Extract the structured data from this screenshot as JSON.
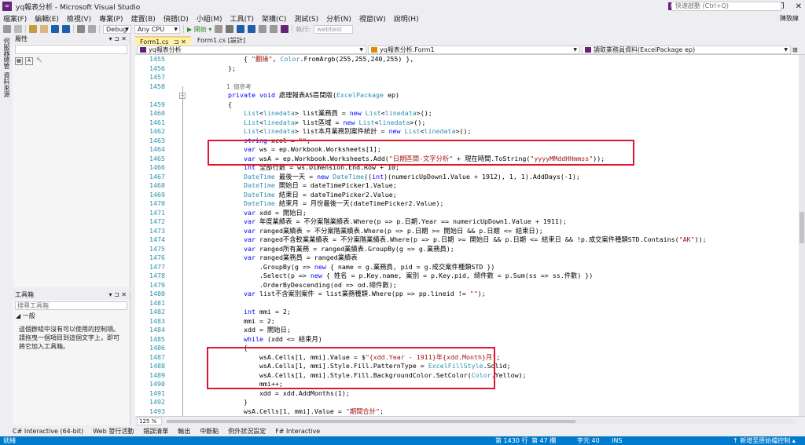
{
  "window": {
    "title": "yq報表分析 - Microsoft Visual Studio",
    "controls": [
      "—",
      "❐",
      "✕"
    ]
  },
  "menu": [
    "檔案(F)",
    "編輯(E)",
    "檢視(V)",
    "專案(P)",
    "建置(B)",
    "偵錯(D)",
    "小組(M)",
    "工具(T)",
    "架構(C)",
    "測試(S)",
    "分析(N)",
    "視窗(W)",
    "說明(H)"
  ],
  "quick_launch_placeholder": "快速啟動 (Ctrl+Q)",
  "user": "陳致緯",
  "toolbar": {
    "config": "Debug",
    "platform": "Any CPU",
    "start": "▶ 開始 ▾",
    "branch_label": "執行:",
    "branch": "webtest"
  },
  "left_strip": [
    "伺服器總管",
    "資料來源"
  ],
  "properties": {
    "title": "屬性",
    "pin": "▾ ⊐ ✕"
  },
  "toolbox": {
    "title": "工具箱",
    "pin": "▾ ⊐ ✕",
    "search_placeholder": "搜尋工具箱",
    "general": "◢ 一般",
    "message": "這個群組中沒有可以使用的控制項。請拖曳一個項目到這個文字上，即可將它加入工具箱。"
  },
  "editor_tabs": [
    {
      "label": "Form1.cs",
      "pin": "⊐ ✕",
      "active": true
    },
    {
      "label": "Form1.cs [設計]",
      "pin": "",
      "active": false
    }
  ],
  "nav": {
    "project": "yq報表分析",
    "class": "yq報表分析.Form1",
    "member": "讀取業務員資料(ExcelPackage ep)"
  },
  "code_lines": [
    {
      "n": "1455",
      "t": "        { \"翻綠\", Color.FromArgb(255,255,240,255) },",
      "c": "st"
    },
    {
      "n": "1456",
      "t": "    };",
      "c": ""
    },
    {
      "n": "1457",
      "t": "",
      "c": ""
    },
    {
      "n": "1458",
      "t": "    1 個參考",
      "c": "ref"
    },
    {
      "n": "",
      "t": "    private void 處理報表AS區間版(ExcelPackage ep)",
      "c": "sig"
    },
    {
      "n": "1459",
      "t": "    {",
      "c": ""
    },
    {
      "n": "1460",
      "t": "        List<linedata> list業務員 = new List<linedata>();",
      "c": ""
    },
    {
      "n": "1461",
      "t": "        List<linedata> list區域 = new List<linedata>();",
      "c": ""
    },
    {
      "n": "1462",
      "t": "        List<linedata> list本月業務別案件統計 = new List<linedata>();",
      "c": ""
    },
    {
      "n": "1463",
      "t": "        string xcol = \"\";",
      "c": ""
    },
    {
      "n": "1464",
      "t": "        var ws = ep.Workbook.Worksheets[1];",
      "c": ""
    },
    {
      "n": "1465",
      "t": "        var wsA = ep.Workbook.Worksheets.Add(\"日期區間-文字分析\" + 現在時間.ToString(\"yyyyMMddHHmmss\"));",
      "c": ""
    },
    {
      "n": "1466",
      "t": "        int 全部行數 = ws.Dimension.End.Row + 10;",
      "c": ""
    },
    {
      "n": "1467",
      "t": "        DateTime 最後一天 = new DateTime((int)(numericUpDown1.Value + 1912), 1, 1).AddDays(-1);",
      "c": ""
    },
    {
      "n": "1468",
      "t": "        DateTime 開始日 = dateTimePicker1.Value;",
      "c": ""
    },
    {
      "n": "1469",
      "t": "        DateTime 結束日 = dateTimePicker2.Value;",
      "c": ""
    },
    {
      "n": "1470",
      "t": "        DateTime 結束月 = 月份最後一天(dateTimePicker2.Value);",
      "c": ""
    },
    {
      "n": "1471",
      "t": "        var xdd = 開始日;",
      "c": ""
    },
    {
      "n": "1472",
      "t": "        var 年度業績表 = 不分案階業績表.Where(p => p.日期.Year == numericUpDown1.Value + 1911);",
      "c": ""
    },
    {
      "n": "1473",
      "t": "        var ranged業績表 = 不分案階業績表.Where(p => p.日期 >= 開始日 && p.日期 <= 結束日);",
      "c": ""
    },
    {
      "n": "1474",
      "t": "        var ranged不含較業業績表 = 不分案階業績表.Where(p => p.日期 >= 開始日 && p.日期 <= 結束日 && !p.成交案件種類STD.Contains(\"AK\"));",
      "c": ""
    },
    {
      "n": "1475",
      "t": "        var ranged所有業務 = ranged業績表.GroupBy(g => g.業務員);",
      "c": ""
    },
    {
      "n": "1476",
      "t": "        var ranged業務員 = ranged業績表",
      "c": ""
    },
    {
      "n": "1477",
      "t": "            .GroupBy(g => new { name = g.業務員, pid = g.成交案件種類STD })",
      "c": ""
    },
    {
      "n": "1478",
      "t": "            .Select(p => new { 姓名 = p.Key.name, 案別 = p.Key.pid, 總件數 = p.Sum(ss => ss.件數) })",
      "c": ""
    },
    {
      "n": "1479",
      "t": "            .OrderByDescending(od => od.總件數);",
      "c": ""
    },
    {
      "n": "1480",
      "t": "        var list不含案別案件 = list業務種類.Where(pp => pp.lineid != \"\");",
      "c": ""
    },
    {
      "n": "1481",
      "t": "",
      "c": ""
    },
    {
      "n": "1482",
      "t": "        int mmi = 2;",
      "c": ""
    },
    {
      "n": "1483",
      "t": "        mmi = 2;",
      "c": ""
    },
    {
      "n": "1484",
      "t": "        xdd = 開始日;",
      "c": ""
    },
    {
      "n": "1485",
      "t": "        while (xdd <= 結束月)",
      "c": ""
    },
    {
      "n": "1486",
      "t": "        {",
      "c": ""
    },
    {
      "n": "1487",
      "t": "            wsA.Cells[1, mmi].Value = $\"{xdd.Year - 1911}年{xdd.Month}月\";",
      "c": ""
    },
    {
      "n": "1488",
      "t": "            wsA.Cells[1, mmi].Style.Fill.PatternType = ExcelFillStyle.Solid;",
      "c": ""
    },
    {
      "n": "1489",
      "t": "            wsA.Cells[1, mmi].Style.Fill.BackgroundColor.SetColor(Color.Yellow);",
      "c": ""
    },
    {
      "n": "1490",
      "t": "            mmi++;",
      "c": ""
    },
    {
      "n": "1491",
      "t": "            xdd = xdd.AddMonths(1);",
      "c": ""
    },
    {
      "n": "1492",
      "t": "        }",
      "c": ""
    },
    {
      "n": "1493",
      "t": "        wsA.Cells[1, mmi].Value = \"期間合計\";",
      "c": ""
    },
    {
      "n": "1494",
      "t": "",
      "c": ""
    }
  ],
  "zoom": "125 %",
  "bottom_tabs": [
    "C# Interactive (64-bit)",
    "Web 發行活動",
    "錯誤清單",
    "輸出",
    "中斷點",
    "例外狀況設定",
    "F# Interactive"
  ],
  "status": {
    "left": "就緒",
    "row": "第 1430 行",
    "col": "第 47 欄",
    "char": "字元 40",
    "mode": "INS",
    "right": "↑ 新增至原始檔控制 ▴"
  },
  "colors": {
    "status_bar": "#007acc",
    "highlight_box": "#e0162b",
    "keyword": "#0000ff",
    "type": "#2b91af",
    "string": "#a31515"
  }
}
